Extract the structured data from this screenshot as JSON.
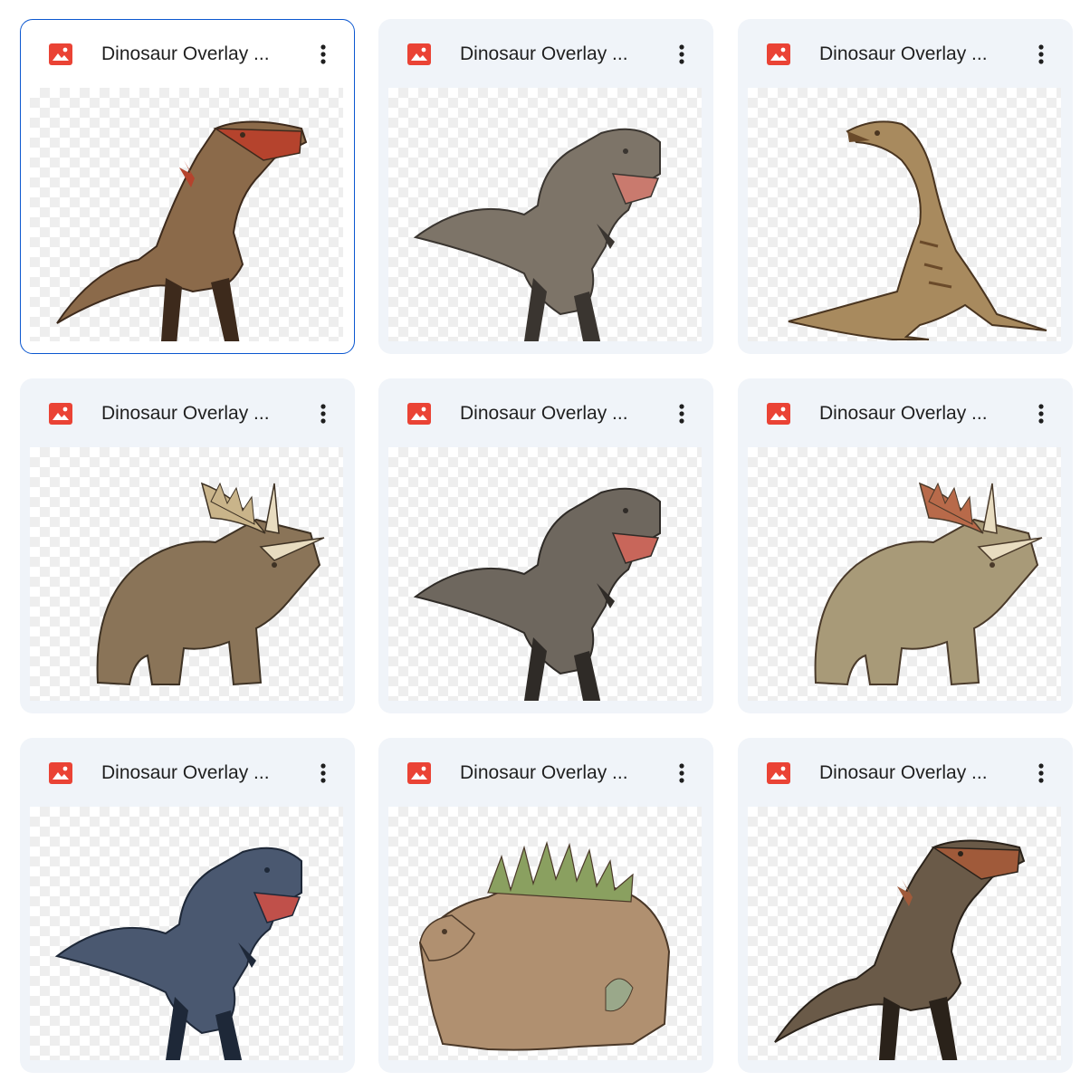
{
  "files": [
    {
      "title": "Dinosaur Overlay ...",
      "kind": "raptor",
      "palette": {
        "body": "#8b6a4a",
        "accent": "#b5432d",
        "dark": "#3d2a1c"
      },
      "selected": true
    },
    {
      "title": "Dinosaur Overlay ...",
      "kind": "trex",
      "palette": {
        "body": "#7d7468",
        "accent": "#c97a6e",
        "dark": "#3a3530"
      },
      "selected": false
    },
    {
      "title": "Dinosaur Overlay ...",
      "kind": "compy",
      "palette": {
        "body": "#a88a5e",
        "accent": "#6a4a2a",
        "dark": "#4a3520"
      },
      "selected": false
    },
    {
      "title": "Dinosaur Overlay ...",
      "kind": "triceratops",
      "palette": {
        "body": "#8a7458",
        "accent": "#c9b48a",
        "dark": "#3e3224"
      },
      "selected": false
    },
    {
      "title": "Dinosaur Overlay ...",
      "kind": "trex",
      "palette": {
        "body": "#6e675e",
        "accent": "#c8665a",
        "dark": "#2f2b27"
      },
      "selected": false
    },
    {
      "title": "Dinosaur Overlay ...",
      "kind": "triceratops",
      "palette": {
        "body": "#a89a78",
        "accent": "#b86a4a",
        "dark": "#4a3a2a"
      },
      "selected": false
    },
    {
      "title": "Dinosaur Overlay ...",
      "kind": "trex",
      "palette": {
        "body": "#4a5870",
        "accent": "#c0504a",
        "dark": "#1e2838"
      },
      "selected": false
    },
    {
      "title": "Dinosaur Overlay ...",
      "kind": "ankylo",
      "palette": {
        "body": "#b09070",
        "accent": "#8aa060",
        "dark": "#4a3828"
      },
      "selected": false
    },
    {
      "title": "Dinosaur Overlay ...",
      "kind": "raptor",
      "palette": {
        "body": "#6a5a48",
        "accent": "#a05a3a",
        "dark": "#2a221a"
      },
      "selected": false
    }
  ],
  "icons": {
    "file": "image-file-icon",
    "more": "more-vert-icon"
  },
  "colors": {
    "file_icon": "#ea4335",
    "card_bg": "#f0f4f9",
    "selected_border": "#0b57d0",
    "title_text": "#1f1f1f",
    "more_icon": "#1f1f1f"
  }
}
